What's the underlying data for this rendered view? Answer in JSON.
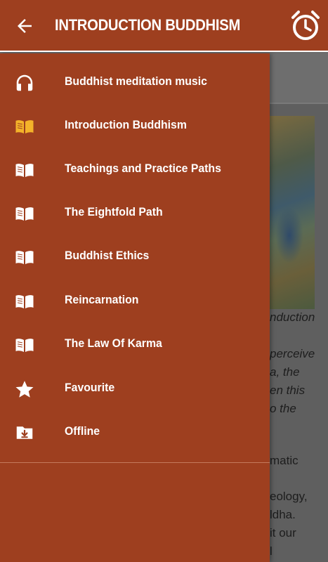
{
  "appbar": {
    "title": "INTRODUCTION BUDDHISM",
    "back_icon": "arrow-left",
    "alarm_icon": "alarm-clock"
  },
  "colors": {
    "primary": "#9e3f1f",
    "active_icon": "#f4b32a",
    "text": "#ffffff"
  },
  "drawer": {
    "items": [
      {
        "label": "Buddhist meditation music",
        "icon": "headphones-icon",
        "active": false
      },
      {
        "label": "Introduction Buddhism",
        "icon": "book-open-icon",
        "active": true
      },
      {
        "label": "Teachings and Practice Paths",
        "icon": "book-open-icon",
        "active": false
      },
      {
        "label": "The Eightfold Path",
        "icon": "book-open-icon",
        "active": false
      },
      {
        "label": "Buddhist Ethics",
        "icon": "book-open-icon",
        "active": false
      },
      {
        "label": "Reincarnation",
        "icon": "book-open-icon",
        "active": false
      },
      {
        "label": "The Law Of Karma",
        "icon": "book-open-icon",
        "active": false
      },
      {
        "label": "Favourite",
        "icon": "star-icon",
        "active": false
      },
      {
        "label": "Offline",
        "icon": "download-folder-icon",
        "active": false
      }
    ]
  },
  "content": {
    "lines": [
      {
        "text": "nduction",
        "italic": true
      },
      {
        "text": "perceive",
        "italic": true
      },
      {
        "text": "a, the",
        "italic": true
      },
      {
        "text": "en this",
        "italic": true
      },
      {
        "text": "o the",
        "italic": true
      },
      {
        "text": "matic",
        "italic": false
      },
      {
        "text": "eology,",
        "italic": false
      },
      {
        "text": "ldha.",
        "italic": false
      },
      {
        "text": "it our",
        "italic": false
      },
      {
        "text": "l",
        "italic": false
      }
    ]
  }
}
